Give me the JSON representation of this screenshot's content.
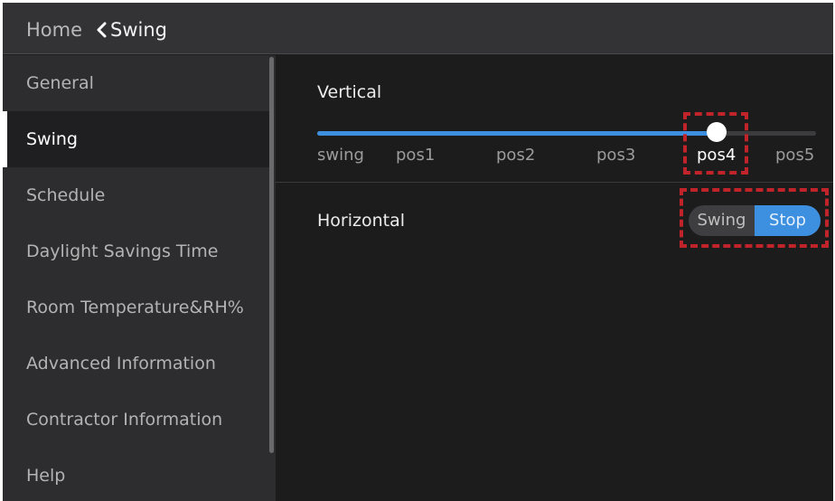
{
  "breadcrumb": {
    "home_label": "Home",
    "current_label": "Swing"
  },
  "sidebar": {
    "items": [
      {
        "label": "General",
        "active": false
      },
      {
        "label": "Swing",
        "active": true
      },
      {
        "label": "Schedule",
        "active": false
      },
      {
        "label": "Daylight Savings Time",
        "active": false
      },
      {
        "label": "Room Temperature&RH%",
        "active": false
      },
      {
        "label": "Advanced Information",
        "active": false
      },
      {
        "label": "Contractor Information",
        "active": false
      },
      {
        "label": "Help",
        "active": false
      }
    ]
  },
  "vertical": {
    "label": "Vertical",
    "options": [
      "swing",
      "pos1",
      "pos2",
      "pos3",
      "pos4",
      "pos5"
    ],
    "selected_index": 4
  },
  "horizontal": {
    "label": "Horizontal",
    "options": [
      "Swing",
      "Stop"
    ],
    "selected": "Stop"
  },
  "colors": {
    "accent": "#3d8fe0",
    "highlight": "#c0242a",
    "topbar": "#333335",
    "sidebar": "#2d2d2f",
    "content": "#1c1c1c"
  },
  "icons": {
    "back": "chevron-left-icon"
  }
}
